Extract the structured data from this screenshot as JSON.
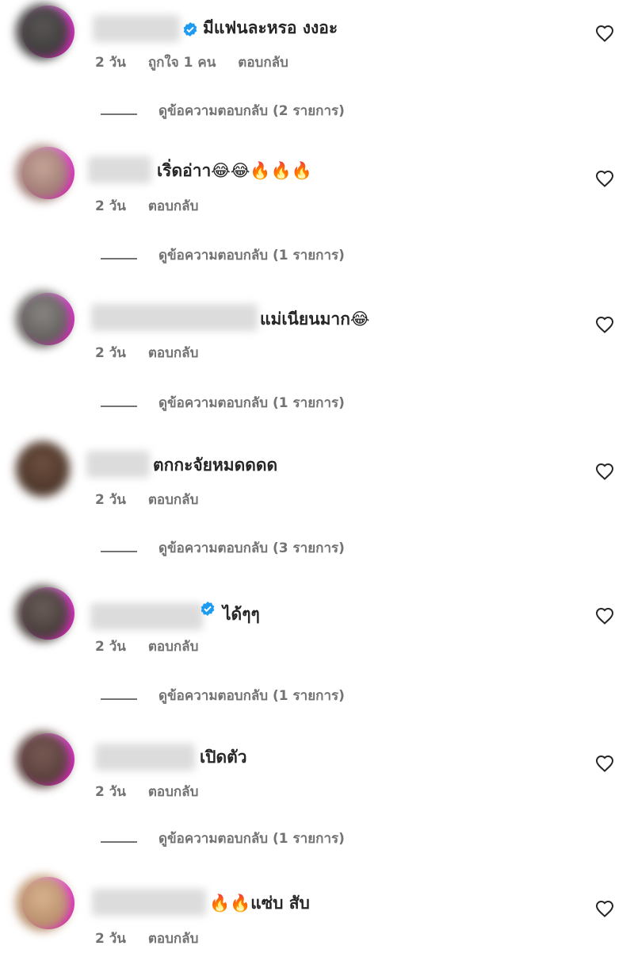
{
  "icons": {
    "like": "heart-outline-icon",
    "verified": "verified-badge-icon"
  },
  "colors": {
    "verified": "#1d9bf0",
    "meta_text": "#737373",
    "story_ring": "#d21ea8"
  },
  "comments": [
    {
      "text": "มีแฟนละหรอ งงอะ",
      "time": "2 วัน",
      "likes": "ถูกใจ 1 คน",
      "reply": "ตอบกลับ",
      "view_replies": "ดูข้อความตอบกลับ (2 รายการ)"
    },
    {
      "text": "เริ่ดอ่าา😂😂🔥🔥🔥",
      "time": "2 วัน",
      "reply": "ตอบกลับ",
      "view_replies": "ดูข้อความตอบกลับ (1 รายการ)"
    },
    {
      "text": "แม่เนียนมาก😂",
      "time": "2 วัน",
      "reply": "ตอบกลับ",
      "view_replies": "ดูข้อความตอบกลับ (1 รายการ)"
    },
    {
      "text": "ตกกะจัยหมดดดด",
      "time": "2 วัน",
      "reply": "ตอบกลับ",
      "view_replies": "ดูข้อความตอบกลับ (3 รายการ)"
    },
    {
      "text": "ได้ๆๆ",
      "time": "2 วัน",
      "reply": "ตอบกลับ",
      "view_replies": "ดูข้อความตอบกลับ (1 รายการ)"
    },
    {
      "text": "เปิดตัว",
      "time": "2 วัน",
      "reply": "ตอบกลับ",
      "view_replies": "ดูข้อความตอบกลับ (1 รายการ)"
    },
    {
      "text": "🔥🔥แซ่บ สับ",
      "time": "2 วัน",
      "reply": "ตอบกลับ"
    }
  ]
}
